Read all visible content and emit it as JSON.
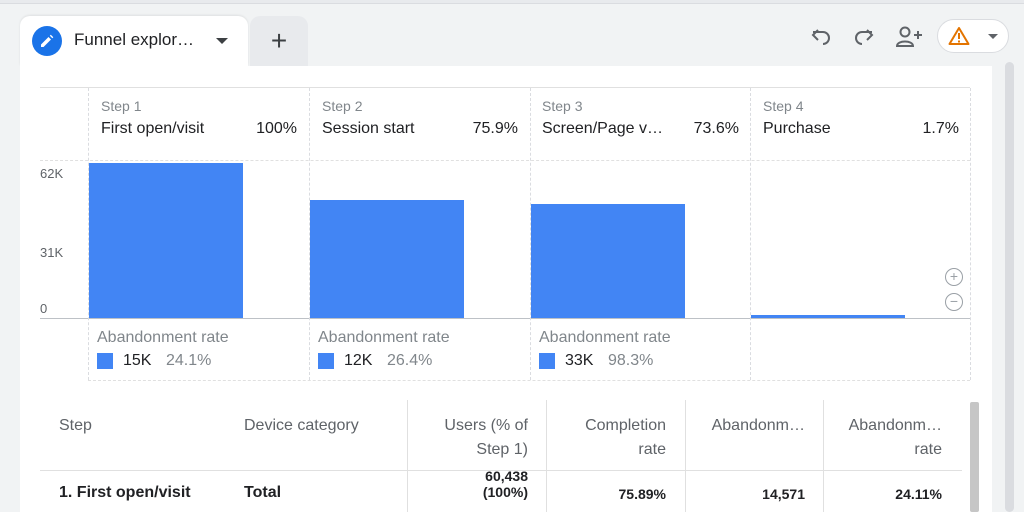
{
  "tabs": {
    "active_title": "Funnel explor…",
    "add_label": "+"
  },
  "colors": {
    "accent": "#1a73e8",
    "bar": "#4285f4",
    "warning": "#e37400"
  },
  "toolbar": {
    "undo_icon": "undo-icon",
    "redo_icon": "redo-icon",
    "share_icon": "add-user-icon",
    "warning_icon": "warning-icon"
  },
  "funnel": {
    "y_ticks": [
      "62K",
      "31K",
      "0"
    ],
    "steps": [
      {
        "step": "Step 1",
        "name": "First open/visit",
        "pct": "100%",
        "abandon_label": "Abandonment rate",
        "abandon_count": "15K",
        "abandon_rate": "24.1%",
        "value_fraction": 1.0
      },
      {
        "step": "Step 2",
        "name": "Session start",
        "pct": "75.9%",
        "abandon_label": "Abandonment rate",
        "abandon_count": "12K",
        "abandon_rate": "26.4%",
        "value_fraction": 0.759
      },
      {
        "step": "Step 3",
        "name": "Screen/Page v…",
        "pct": "73.6%",
        "abandon_label": "Abandonment rate",
        "abandon_count": "33K",
        "abandon_rate": "98.3%",
        "value_fraction": 0.736
      },
      {
        "step": "Step 4",
        "name": "Purchase",
        "pct": "1.7%",
        "value_fraction": 0.017
      }
    ]
  },
  "table": {
    "headers": {
      "step": "Step",
      "device": "Device category",
      "users_1": "Users (% of",
      "users_2": "Step 1)",
      "completion_1": "Completion",
      "completion_2": "rate",
      "abandon_count": "Abandonm…",
      "abandon_rate_1": "Abandonm…",
      "abandon_rate_2": "rate"
    },
    "row": {
      "step": "1. First open/visit",
      "device": "Total",
      "users_1": "60,438",
      "users_2": "(100%)",
      "completion": "75.89%",
      "abandon_count": "14,571",
      "abandon_rate": "24.11%"
    }
  }
}
